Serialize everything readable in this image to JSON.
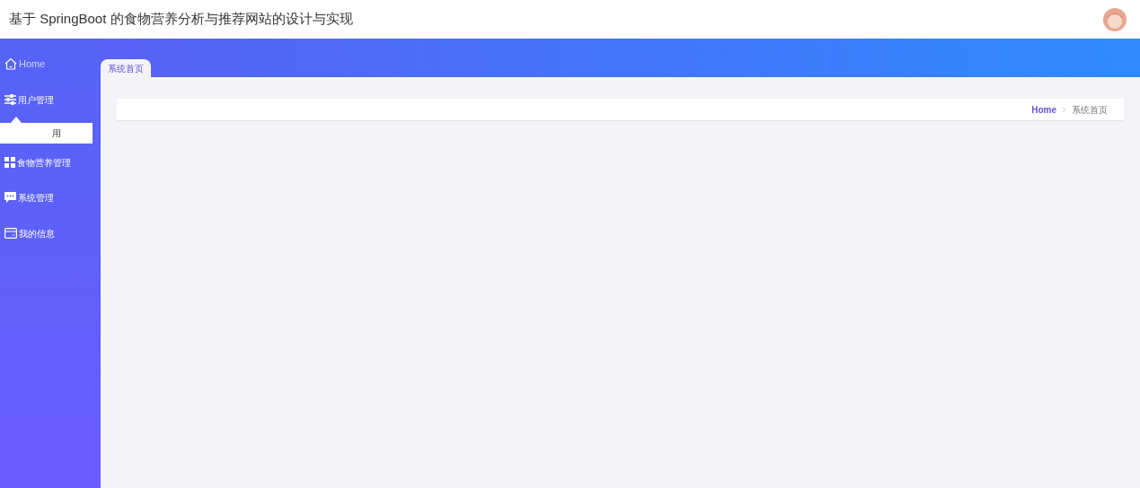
{
  "header": {
    "title": "基于 SpringBoot 的食物营养分析与推荐网站的设计与实现"
  },
  "sidebar": {
    "items": [
      {
        "label": "Home",
        "kind": "home"
      },
      {
        "label": "用户管理",
        "kind": "sliders",
        "children": [
          {
            "label": "用"
          }
        ]
      },
      {
        "label": "食物营养管理",
        "kind": "grid"
      },
      {
        "label": "系统管理",
        "kind": "chat"
      },
      {
        "label": "我的信息",
        "kind": "card"
      }
    ]
  },
  "tabs": [
    {
      "label": "系统首页",
      "selected": true
    }
  ],
  "breadcrumb": [
    "Home",
    "系统首页"
  ]
}
